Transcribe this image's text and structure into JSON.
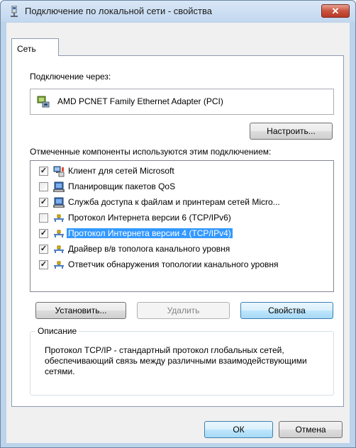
{
  "window": {
    "title": "Подключение по локальной сети - свойства",
    "close_symbol": "✕"
  },
  "tabs": [
    {
      "label": "Сеть",
      "active": true
    }
  ],
  "connect_via": {
    "label": "Подключение через:",
    "adapter_name": "AMD PCNET Family Ethernet Adapter (PCI)",
    "adapter_icon": "network-adapter-icon"
  },
  "configure_button": "Настроить...",
  "components_label": "Отмеченные компоненты используются этим подключением:",
  "components": [
    {
      "label": "Клиент для сетей Microsoft",
      "checked": true,
      "icon": "network-client-icon",
      "selected": false
    },
    {
      "label": "Планировщик пакетов QoS",
      "checked": false,
      "icon": "network-service-icon",
      "selected": false
    },
    {
      "label": "Служба доступа к файлам и принтерам сетей Micro...",
      "checked": true,
      "icon": "network-service-icon",
      "selected": false
    },
    {
      "label": "Протокол Интернета версии 6 (TCP/IPv6)",
      "checked": false,
      "icon": "network-protocol-icon",
      "selected": false
    },
    {
      "label": "Протокол Интернета версии 4 (TCP/IPv4)",
      "checked": true,
      "icon": "network-protocol-icon",
      "selected": true
    },
    {
      "label": "Драйвер в/в тополога канального уровня",
      "checked": true,
      "icon": "network-protocol-icon",
      "selected": false
    },
    {
      "label": "Ответчик обнаружения топологии канального уровня",
      "checked": true,
      "icon": "network-protocol-icon",
      "selected": false
    }
  ],
  "buttons": {
    "install": "Установить...",
    "remove": "Удалить",
    "properties": "Свойства",
    "ok": "ОК",
    "cancel": "Отмена"
  },
  "description": {
    "legend": "Описание",
    "text": "Протокол TCP/IP - стандартный протокол глобальных сетей, обеспечивающий связь между различными взаимодействующими сетями."
  },
  "colors": {
    "selection": "#3399ff",
    "title_gradient_top": "#d9e7f6",
    "close_button": "#c8533f"
  }
}
